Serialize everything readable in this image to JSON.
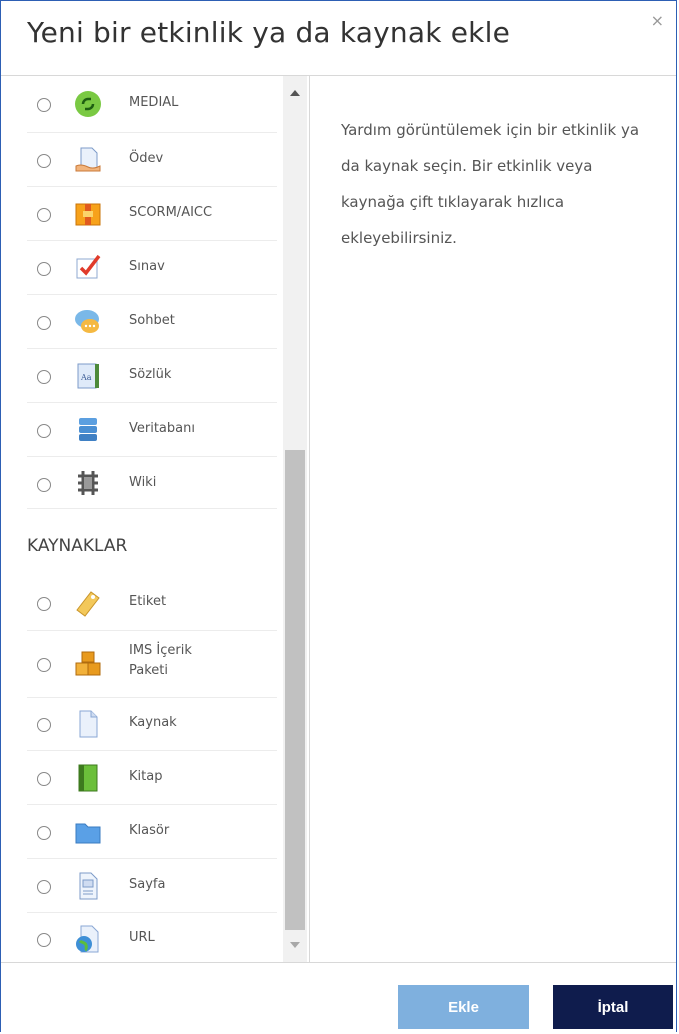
{
  "dialog": {
    "title": "Yeni bir etkinlik ya da kaynak ekle",
    "close_symbol": "×"
  },
  "activities": [
    {
      "label": "MEDIAL",
      "icon": "medial-icon"
    },
    {
      "label": "Ödev",
      "icon": "assignment-icon"
    },
    {
      "label": "SCORM/AICC",
      "icon": "scorm-package-icon"
    },
    {
      "label": "Sınav",
      "icon": "quiz-icon"
    },
    {
      "label": "Sohbet",
      "icon": "chat-icon"
    },
    {
      "label": "Sözlük",
      "icon": "glossary-icon"
    },
    {
      "label": "Veritabanı",
      "icon": "database-icon"
    },
    {
      "label": "Wiki",
      "icon": "wiki-icon"
    }
  ],
  "resources_heading": "KAYNAKLAR",
  "resources": [
    {
      "label": "Etiket",
      "icon": "label-tag-icon"
    },
    {
      "label": "IMS İçerik Paketi",
      "icon": "ims-package-icon"
    },
    {
      "label": "Kaynak",
      "icon": "file-icon"
    },
    {
      "label": "Kitap",
      "icon": "book-icon"
    },
    {
      "label": "Klasör",
      "icon": "folder-icon"
    },
    {
      "label": "Sayfa",
      "icon": "page-icon"
    },
    {
      "label": "URL",
      "icon": "url-icon"
    }
  ],
  "help_text": "Yardım görüntülemek için bir etkinlik ya da kaynak seçin. Bir etkinlik veya kaynağa çift tıklayarak hızlıca ekleyebilirsiniz.",
  "buttons": {
    "add": "Ekle",
    "cancel": "İptal"
  },
  "colors": {
    "add_button": "#7fb0de",
    "cancel_button": "#0f1c4d",
    "dialog_border": "#2d5fb4"
  }
}
